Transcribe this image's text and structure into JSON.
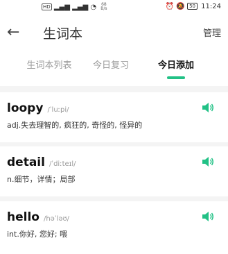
{
  "status_bar": {
    "hd": "HD",
    "signal1": "ᵃᶫˡ",
    "signal2": "ᵃᶫˡ",
    "speed_value": "68",
    "speed_unit": "B/s",
    "battery": "50",
    "time": "11:24"
  },
  "header": {
    "title": "生词本",
    "manage_label": "管理"
  },
  "tabs": [
    {
      "label": "生词本列表"
    },
    {
      "label": "今日复习"
    },
    {
      "label": "今日添加"
    }
  ],
  "words": [
    {
      "word": "loopy",
      "phonetic": "/ˈluːpi/",
      "definition": "adj.失去理智的, 疯狂的, 奇怪的, 怪异的"
    },
    {
      "word": "detail",
      "phonetic": "/ˈdiːteɪl/",
      "definition": "n.细节，详情；局部"
    },
    {
      "word": "hello",
      "phonetic": "/həˈləʊ/",
      "definition": "int.你好, 您好; 喂"
    }
  ],
  "colors": {
    "accent": "#22c186"
  }
}
